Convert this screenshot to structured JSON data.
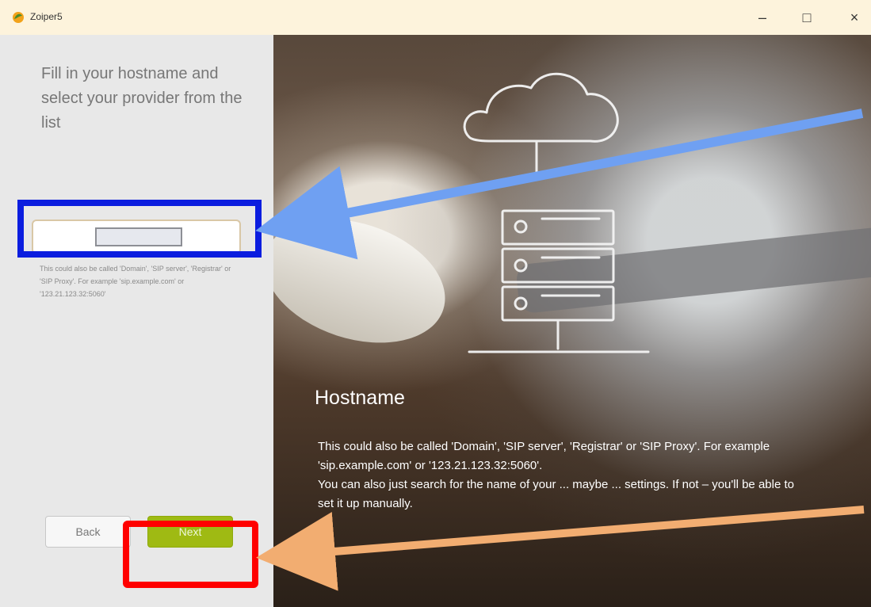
{
  "window": {
    "title": "Zoiper5",
    "controls": {
      "minimize": "–",
      "maximize": "□",
      "close": "×"
    }
  },
  "left_panel": {
    "instruction": "Fill in your hostname and select your provider from the list",
    "hostname_input": {
      "value": "",
      "placeholder": ""
    },
    "hint": "This could also be called 'Domain', 'SIP server', 'Registrar' or 'SIP Proxy'. For example 'sip.example.com' or '123.21.123.32:5060'",
    "buttons": {
      "back": "Back",
      "next": "Next"
    }
  },
  "hero": {
    "title": "Hostname",
    "description": "This could also be called 'Domain', 'SIP server', 'Registrar' or 'SIP Proxy'. For example 'sip.example.com' or '123.21.123.32:5060'.\nYou can also just search for the name of your ... maybe ... settings. If not – you'll be able to set it up manually."
  },
  "annotations": {
    "input_highlight_color": "#0b1ddf",
    "next_highlight_color": "#ff0000",
    "blue_arrow_color": "#6fa0f2",
    "orange_arrow_color": "#f2ad71"
  }
}
